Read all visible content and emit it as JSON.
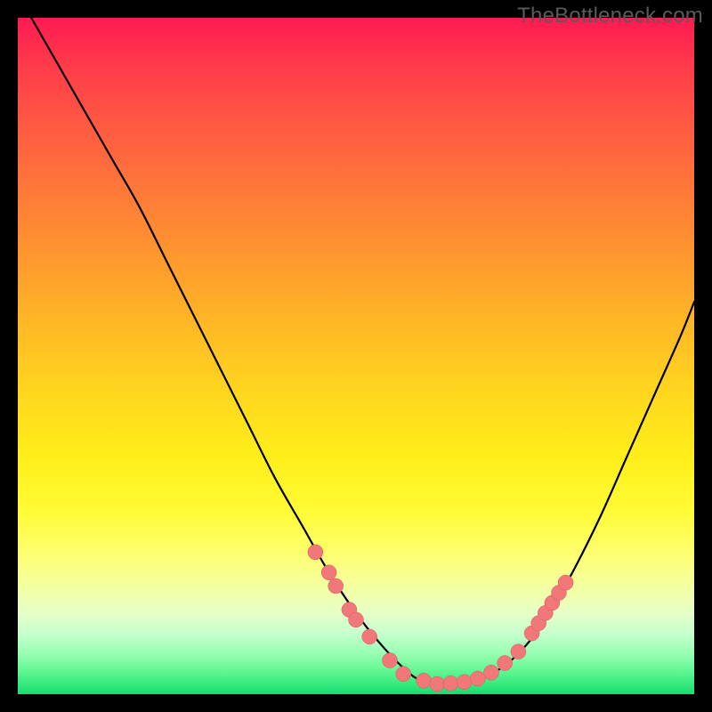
{
  "watermark": "TheBottleneck.com",
  "colors": {
    "dot_fill": "#f07878",
    "dot_stroke": "#d85a5a",
    "curve_stroke": "#000000",
    "frame_bg": "#000000"
  },
  "chart_data": {
    "type": "line",
    "title": "",
    "xlabel": "",
    "ylabel": "",
    "xlim": [
      0,
      100
    ],
    "ylim": [
      0,
      100
    ],
    "grid": false,
    "legend": false,
    "series": [
      {
        "name": "bottleneck-curve",
        "x": [
          2,
          6,
          10,
          14,
          18,
          22,
          26,
          30,
          34,
          38,
          42,
          46,
          50,
          54,
          58,
          60,
          62,
          66,
          70,
          74,
          78,
          82,
          86,
          90,
          94,
          98,
          100
        ],
        "y": [
          100,
          93,
          86,
          79,
          72,
          64,
          56,
          48,
          40,
          32,
          25,
          18,
          12,
          7,
          3,
          2,
          1.5,
          1.7,
          3,
          6,
          11,
          18,
          26,
          35,
          44,
          53,
          58
        ]
      }
    ],
    "markers": [
      {
        "x": 44,
        "y": 21
      },
      {
        "x": 46,
        "y": 18
      },
      {
        "x": 47,
        "y": 16
      },
      {
        "x": 49,
        "y": 12.5
      },
      {
        "x": 50,
        "y": 11
      },
      {
        "x": 52,
        "y": 8.5
      },
      {
        "x": 55,
        "y": 5
      },
      {
        "x": 57,
        "y": 3
      },
      {
        "x": 60,
        "y": 2
      },
      {
        "x": 62,
        "y": 1.5
      },
      {
        "x": 64,
        "y": 1.6
      },
      {
        "x": 66,
        "y": 1.8
      },
      {
        "x": 68,
        "y": 2.3
      },
      {
        "x": 70,
        "y": 3.2
      },
      {
        "x": 72,
        "y": 4.6
      },
      {
        "x": 74,
        "y": 6.3
      },
      {
        "x": 76,
        "y": 9
      },
      {
        "x": 77,
        "y": 10.5
      },
      {
        "x": 78,
        "y": 12
      },
      {
        "x": 79,
        "y": 13.5
      },
      {
        "x": 80,
        "y": 15
      },
      {
        "x": 81,
        "y": 16.5
      }
    ],
    "marker_radius": 8.5,
    "annotations": []
  }
}
